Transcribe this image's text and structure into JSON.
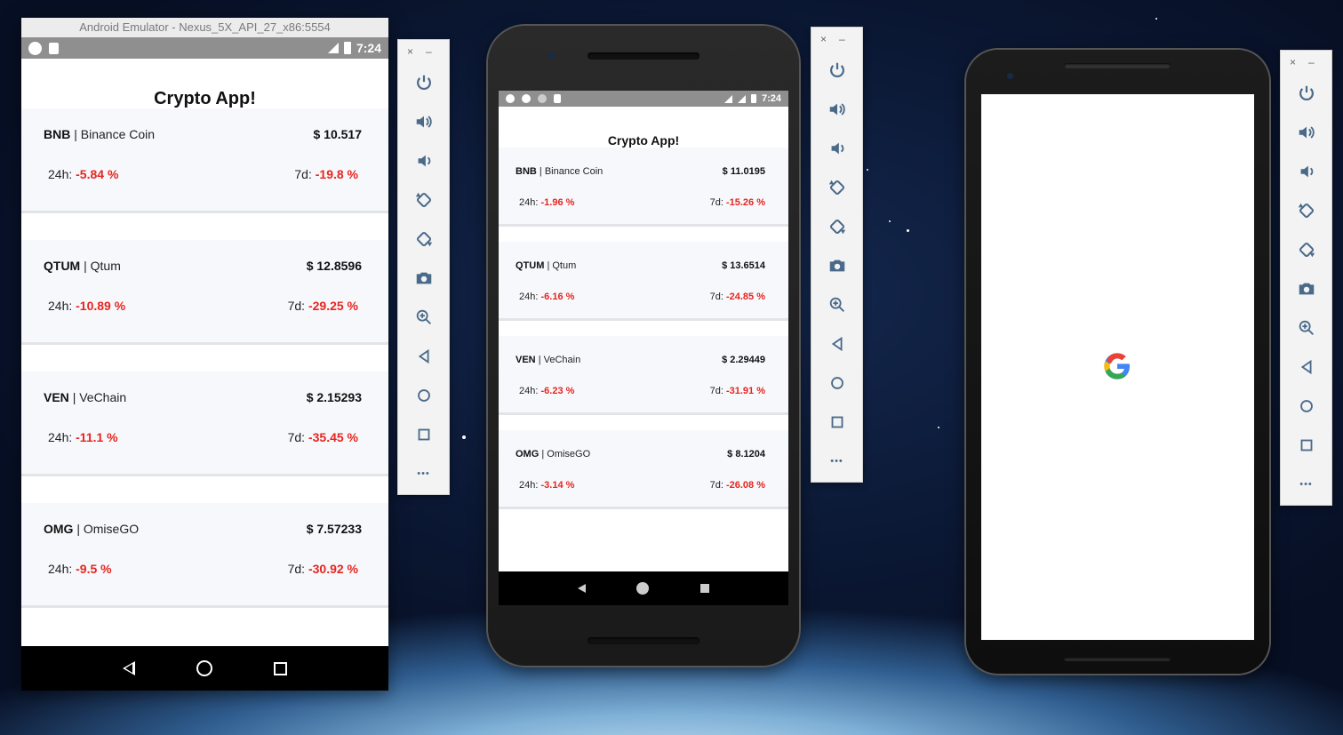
{
  "emulator_window": {
    "title": "Android Emulator - Nexus_5X_API_27_x86:5554"
  },
  "statusbar": {
    "time": "7:24"
  },
  "app": {
    "title": "Crypto App!",
    "h24_label": "24h:",
    "d7_label": "7d:",
    "separator": "|"
  },
  "emulator1": {
    "coins": [
      {
        "symbol": "BNB",
        "name": "Binance Coin",
        "price": "$ 10.517",
        "change_24h": "-5.84 %",
        "change_7d": "-19.8 %"
      },
      {
        "symbol": "QTUM",
        "name": "Qtum",
        "price": "$ 12.8596",
        "change_24h": "-10.89 %",
        "change_7d": "-29.25 %"
      },
      {
        "symbol": "VEN",
        "name": "VeChain",
        "price": "$ 2.15293",
        "change_24h": "-11.1 %",
        "change_7d": "-35.45 %"
      },
      {
        "symbol": "OMG",
        "name": "OmiseGO",
        "price": "$ 7.57233",
        "change_24h": "-9.5 %",
        "change_7d": "-30.92 %"
      }
    ]
  },
  "emulator2": {
    "coins": [
      {
        "symbol": "BNB",
        "name": "Binance Coin",
        "price": "$ 11.0195",
        "change_24h": "-1.96 %",
        "change_7d": "-15.26 %"
      },
      {
        "symbol": "QTUM",
        "name": "Qtum",
        "price": "$ 13.6514",
        "change_24h": "-6.16 %",
        "change_7d": "-24.85 %"
      },
      {
        "symbol": "VEN",
        "name": "VeChain",
        "price": "$ 2.29449",
        "change_24h": "-6.23 %",
        "change_7d": "-31.91 %"
      },
      {
        "symbol": "OMG",
        "name": "OmiseGO",
        "price": "$ 8.1204",
        "change_24h": "-3.14 %",
        "change_7d": "-26.08 %"
      }
    ]
  },
  "toolbar": {
    "close": "×",
    "minimize": "–",
    "more": "•••",
    "icons": [
      "power-icon",
      "volume-up-icon",
      "volume-down-icon",
      "rotate-left-icon",
      "rotate-right-icon",
      "camera-icon",
      "zoom-icon",
      "back-icon",
      "home-icon",
      "overview-icon"
    ]
  },
  "colors": {
    "negative": "#e5261f",
    "toolbar_icon": "#4a6a8a"
  }
}
